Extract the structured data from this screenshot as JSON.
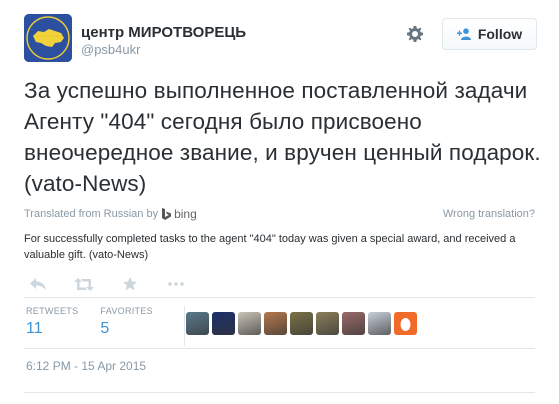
{
  "header": {
    "display_name": "центр МИРОТВОРЕЦЬ",
    "handle": "@psb4ukr",
    "follow_label": "Follow",
    "avatar_icon": "ukraine-map-logo-icon",
    "settings_icon": "gear-icon",
    "follow_icon": "add-user-icon"
  },
  "tweet": {
    "text": "За успешно выполненное поставленной задачи Агенту \"404\" сегодня было присвоено внеочередное звание, и вручен ценный подарок. (vato-News)"
  },
  "translation": {
    "from_label": "Translated from Russian by",
    "provider": "bing",
    "wrong_label": "Wrong translation?",
    "text": "For successfully completed tasks to the agent \"404\" today was given a special award, and received a valuable gift. (vato-News)"
  },
  "actions": {
    "icons": [
      "reply-icon",
      "retweet-icon",
      "favorite-icon",
      "more-icon"
    ]
  },
  "stats": {
    "retweets_label": "RETWEETS",
    "retweets_count": "11",
    "favorites_label": "FAVORITES",
    "favorites_count": "5"
  },
  "favoriters": {
    "avatar_colors": [
      "#5a7a8c",
      "#1c2f6b",
      "#c9c2b8",
      "#b5784e",
      "#7a7248",
      "#8a7e5a",
      "#9a6a6a",
      "#c7cfd8",
      "#f06a2a"
    ]
  },
  "meta": {
    "timestamp": "6:12 PM - 15 Apr 2015"
  },
  "colors": {
    "link_blue": "#3b94d9",
    "muted": "#8899a6",
    "text": "#292f33"
  }
}
